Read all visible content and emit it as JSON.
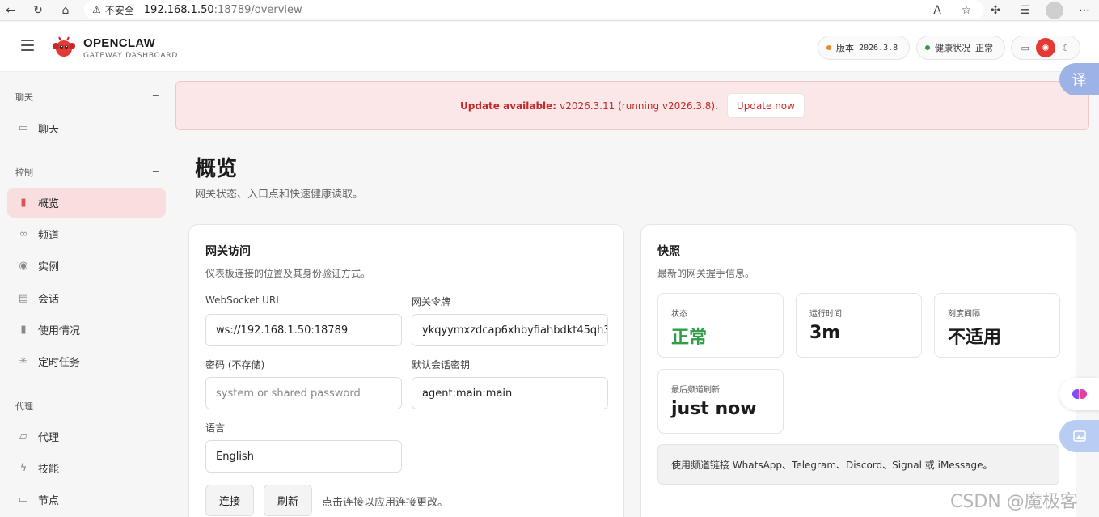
{
  "browser": {
    "insecure_label": "不安全",
    "url_host": "192.168.1.50",
    "url_path": ":18789/overview"
  },
  "header": {
    "brand_title": "OPENCLAW",
    "brand_sub": "GATEWAY DASHBOARD",
    "version_label": "版本",
    "version_value": "2026.3.8",
    "health_label": "健康状况",
    "health_value": "正常"
  },
  "sidebar": {
    "groups": [
      {
        "label": "聊天",
        "collapse": "−"
      },
      {
        "label": "控制",
        "collapse": "−"
      },
      {
        "label": "代理",
        "collapse": "−"
      }
    ],
    "items": [
      {
        "label": "聊天",
        "icon": "message-icon"
      },
      {
        "label": "概览",
        "icon": "bar-chart-icon"
      },
      {
        "label": "频道",
        "icon": "link-icon"
      },
      {
        "label": "实例",
        "icon": "broadcast-icon"
      },
      {
        "label": "会话",
        "icon": "document-icon"
      },
      {
        "label": "使用情况",
        "icon": "bar-chart-icon"
      },
      {
        "label": "定时任务",
        "icon": "loader-icon"
      },
      {
        "label": "代理",
        "icon": "folder-icon"
      },
      {
        "label": "技能",
        "icon": "lightning-icon"
      },
      {
        "label": "节点",
        "icon": "monitor-icon"
      }
    ]
  },
  "banner": {
    "prefix": "Update available:",
    "message": "v2026.3.11 (running v2026.3.8).",
    "button": "Update now"
  },
  "page": {
    "title": "概览",
    "subtitle": "网关状态、入口点和快速健康读取。"
  },
  "gateway_card": {
    "title": "网关访问",
    "subtitle": "仪表板连接的位置及其身份验证方式。",
    "ws_label": "WebSocket URL",
    "ws_value": "ws://192.168.1.50:18789",
    "token_label": "网关令牌",
    "token_value": "ykqyymxzdcap6xhbyfiahbdkt45qh3",
    "password_label": "密码 (不存储)",
    "password_placeholder": "system or shared password",
    "session_label": "默认会话密钥",
    "session_value": "agent:main:main",
    "language_label": "语言",
    "language_value": "English",
    "connect_button": "连接",
    "refresh_button": "刷新",
    "hint": "点击连接以应用连接更改。"
  },
  "snapshot_card": {
    "title": "快照",
    "subtitle": "最新的网关握手信息。",
    "stats": [
      {
        "label": "状态",
        "value": "正常"
      },
      {
        "label": "运行时间",
        "value": "3m"
      },
      {
        "label": "刻度间隔",
        "value": "不适用"
      },
      {
        "label": "最后频道刷新",
        "value": "just now"
      }
    ],
    "note": "使用频道链接 WhatsApp、Telegram、Discord、Signal 或 iMessage。"
  },
  "watermark": "CSDN @魔极客",
  "float": {
    "translate_label": "译"
  },
  "colors": {
    "accent": "#e53935",
    "ok": "#2e9e48",
    "banner_bg": "#fbe7e8"
  }
}
